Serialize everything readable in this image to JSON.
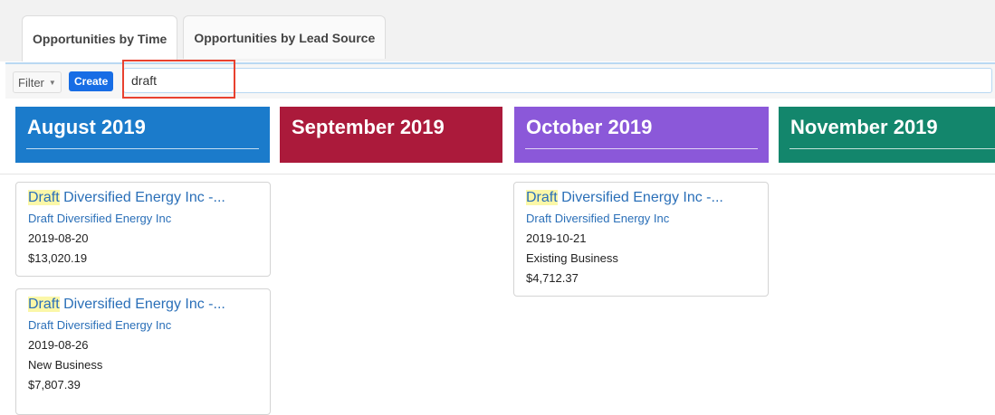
{
  "tabs": [
    {
      "label": "Opportunities by Time"
    },
    {
      "label": "Opportunities by Lead Source"
    }
  ],
  "toolbar": {
    "filter_label": "Filter",
    "create_label": "Create",
    "search_value": "draft"
  },
  "columns": [
    {
      "title": "August 2019",
      "color": "#1b7bcb"
    },
    {
      "title": "September 2019",
      "color": "#ab1a3b"
    },
    {
      "title": "October 2019",
      "color": "#8b58d9"
    },
    {
      "title": "November 2019",
      "color": "#13866c"
    }
  ],
  "cards": [
    {
      "title_highlight": "Draft",
      "title_rest": " Diversified Energy Inc -...",
      "account": "Draft Diversified Energy Inc",
      "date": "2019-08-20",
      "amount": "$13,020.19"
    },
    {
      "title_highlight": "Draft",
      "title_rest": " Diversified Energy Inc -...",
      "account": "Draft Diversified Energy Inc",
      "date": "2019-08-26",
      "type": "New Business",
      "amount": "$7,807.39"
    },
    {
      "title_highlight": "Draft",
      "title_rest": " Diversified Energy Inc -...",
      "account": "Draft Diversified Energy Inc",
      "date": "2019-10-21",
      "type": "Existing Business",
      "amount": "$4,712.37"
    }
  ],
  "colors": {
    "highlight_box": "#e8412f",
    "link": "#2a6fb8",
    "create_button": "#176de5"
  }
}
